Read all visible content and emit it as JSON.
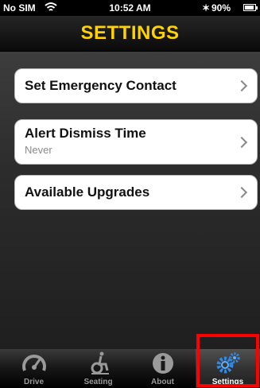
{
  "status_bar": {
    "carrier": "No SIM",
    "wifi_icon": "wifi-icon",
    "time": "10:52 AM",
    "bluetooth_icon": "bluetooth-icon",
    "battery_percent": "90%",
    "battery_level": 0.9
  },
  "header": {
    "title": "SETTINGS",
    "title_color": "#ffd200"
  },
  "settings": {
    "items": [
      {
        "label": "Set Emergency Contact",
        "icon": "chevron-right-icon"
      },
      {
        "label": "Alert Dismiss Time",
        "value": "Never",
        "icon": "chevron-right-icon"
      },
      {
        "label": "Available Upgrades",
        "icon": "chevron-right-icon"
      }
    ]
  },
  "tab_bar": {
    "tabs": [
      {
        "label": "Drive",
        "icon": "speedometer-icon"
      },
      {
        "label": "Seating",
        "icon": "wheelchair-icon"
      },
      {
        "label": "About",
        "icon": "info-icon"
      },
      {
        "label": "Settings",
        "icon": "gears-icon",
        "selected": true
      }
    ],
    "annotation_color": "#ff0000"
  }
}
